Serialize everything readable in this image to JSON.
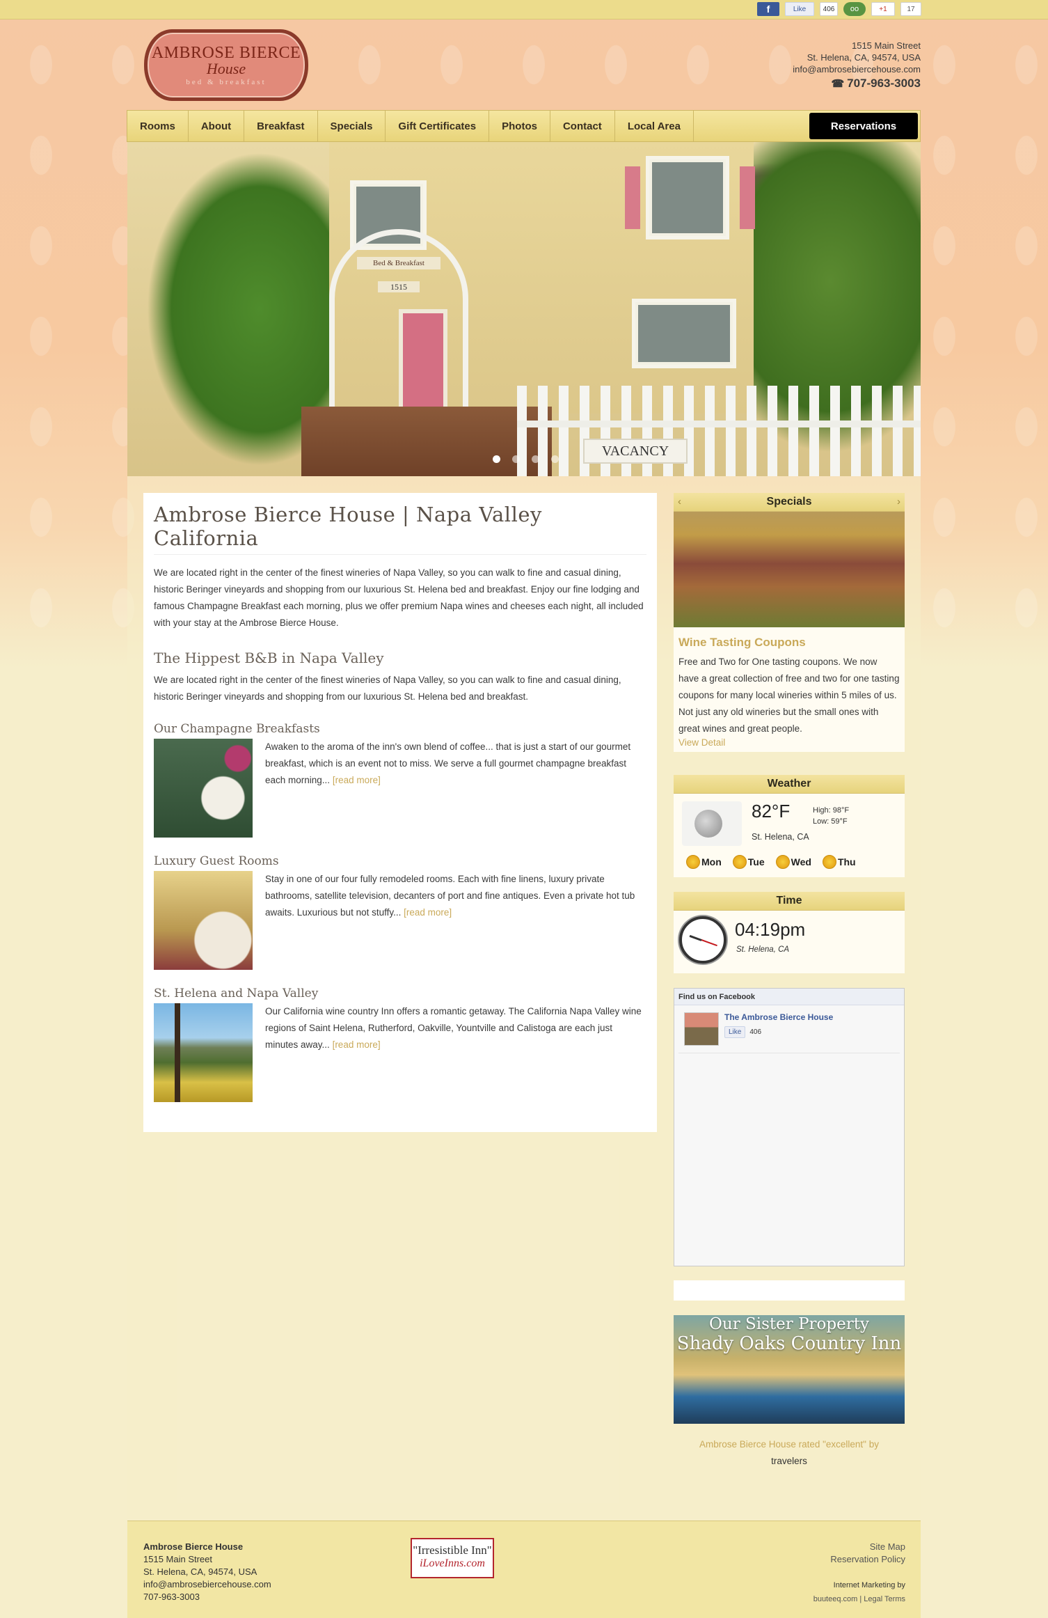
{
  "social": {
    "facebook": "f",
    "fb_like": "Like",
    "fb_count": "406",
    "tripadvisor": "oo",
    "gplus": "+1",
    "gplus_count": "17"
  },
  "header": {
    "logo_line1": "AMBROSE BIERCE",
    "logo_line2": "House",
    "logo_line3": "bed & breakfast",
    "address1": "1515 Main Street",
    "address2": "St. Helena, CA, 94574, USA",
    "email": "info@ambrosebiercehouse.com",
    "phone": "707-963-3003"
  },
  "nav": {
    "items": [
      "Rooms",
      "About",
      "Breakfast",
      "Specials",
      "Gift Certificates",
      "Photos",
      "Contact",
      "Local Area"
    ],
    "reservations": "Reservations"
  },
  "hero": {
    "sign": "Bed & Breakfast",
    "number": "1515",
    "vacancy": "VACANCY",
    "slide_count": 4,
    "active_slide": 1
  },
  "main": {
    "title": "Ambrose Bierce House | Napa Valley California",
    "intro": "We are located right in the center of the finest wineries of Napa Valley, so you can walk to fine and casual dining, historic Beringer vineyards and shopping from our luxurious St. Helena bed and breakfast. Enjoy our fine lodging and famous Champagne Breakfast each morning, plus we offer premium Napa wines and cheeses each night, all included with your stay at the Ambrose Bierce House.",
    "subtitle": "The Hippest B&B in Napa Valley",
    "subtext": "We are located right in the center of the finest wineries of Napa Valley, so you can walk to fine and casual dining, historic Beringer vineyards and shopping from our luxurious St. Helena bed and breakfast.",
    "features": [
      {
        "title": "Our Champagne Breakfasts",
        "text": "Awaken to the aroma of the inn's own blend of coffee... that is just a start of our gourmet breakfast, which is an event not to miss. We serve a full gourmet champagne breakfast each morning...",
        "more": "[read more]"
      },
      {
        "title": "Luxury Guest Rooms",
        "text": "Stay in one of our four fully remodeled rooms. Each with fine linens, luxury private bathrooms, satellite television, decanters of port and fine antiques. Even a private hot tub awaits. Luxurious but not stuffy...",
        "more": "[read more]"
      },
      {
        "title": "St. Helena and Napa Valley",
        "text": "Our California wine country Inn offers a romantic getaway. The California Napa Valley wine regions of Saint Helena, Rutherford, Oakville, Yountville and Calistoga are each just minutes away...",
        "more": "[read more]"
      }
    ]
  },
  "sidebar": {
    "specials": {
      "heading": "Specials",
      "prev": "‹",
      "next": "›",
      "title": "Wine Tasting Coupons",
      "text": "Free and Two for One tasting coupons. We now have a great collection of free and two for one tasting coupons for many local wineries within 5 miles of us. Not just any old wineries but the small ones with great wines and great people.",
      "link": "View Detail"
    },
    "weather": {
      "heading": "Weather",
      "temp": "82°F",
      "high": "High: 98°F",
      "low": "Low: 59°F",
      "location": "St. Helena, CA",
      "days": [
        "Mon",
        "Tue",
        "Wed",
        "Thu"
      ]
    },
    "time": {
      "heading": "Time",
      "value": "04:19pm",
      "location": "St. Helena, CA"
    },
    "facebook": {
      "heading": "Find us on Facebook",
      "page_name": "The Ambrose Bierce House",
      "like": "Like",
      "count": "406"
    },
    "sister": {
      "line1": "Our Sister Property",
      "line2": "Shady Oaks Country Inn"
    },
    "rated": {
      "link": "Ambrose Bierce House",
      "text1": " rated \"excellent\" by",
      "text2": "travelers"
    }
  },
  "footer": {
    "name": "Ambrose Bierce House",
    "address1": "1515 Main Street",
    "address2": "St. Helena, CA, 94574, USA",
    "email": "info@ambrosebiercehouse.com",
    "phone": "707-963-3003",
    "badge1": "\"Irresistible Inn\"",
    "badge2": "iLoveInns.com",
    "sitemap": "Site Map",
    "policy": "Reservation Policy",
    "marketing": "Internet Marketing by",
    "credit": "buuteeq.com  |  Legal Terms"
  }
}
